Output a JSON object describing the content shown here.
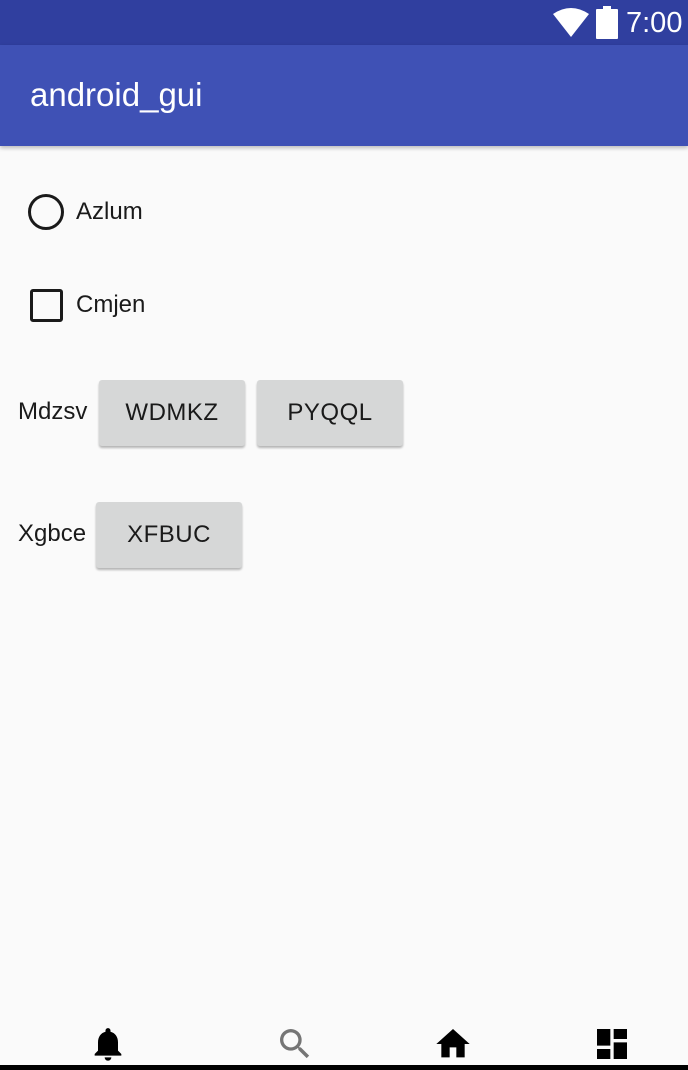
{
  "status_bar": {
    "time": "7:00",
    "icons": [
      "wifi-icon",
      "battery-icon"
    ]
  },
  "app_bar": {
    "title": "android_gui"
  },
  "radio": {
    "label": "Azlum",
    "checked": false
  },
  "checkbox": {
    "label": "Cmjen",
    "checked": false
  },
  "button_groups": [
    {
      "label": "Mdzsv",
      "buttons": [
        "WDMKZ",
        "PYQQL"
      ]
    },
    {
      "label": "Xgbce",
      "buttons": [
        "XFBUC"
      ]
    }
  ],
  "bottom_nav": {
    "items": [
      {
        "icon": "bell-icon",
        "color": "#000000"
      },
      {
        "icon": "search-icon",
        "color": "#757575"
      },
      {
        "icon": "home-icon",
        "color": "#000000"
      },
      {
        "icon": "dashboard-icon",
        "color": "#000000"
      }
    ]
  },
  "colors": {
    "status_bar": "#303f9f",
    "app_bar": "#3f51b5",
    "background": "#fafafa",
    "button": "#d6d7d7"
  }
}
